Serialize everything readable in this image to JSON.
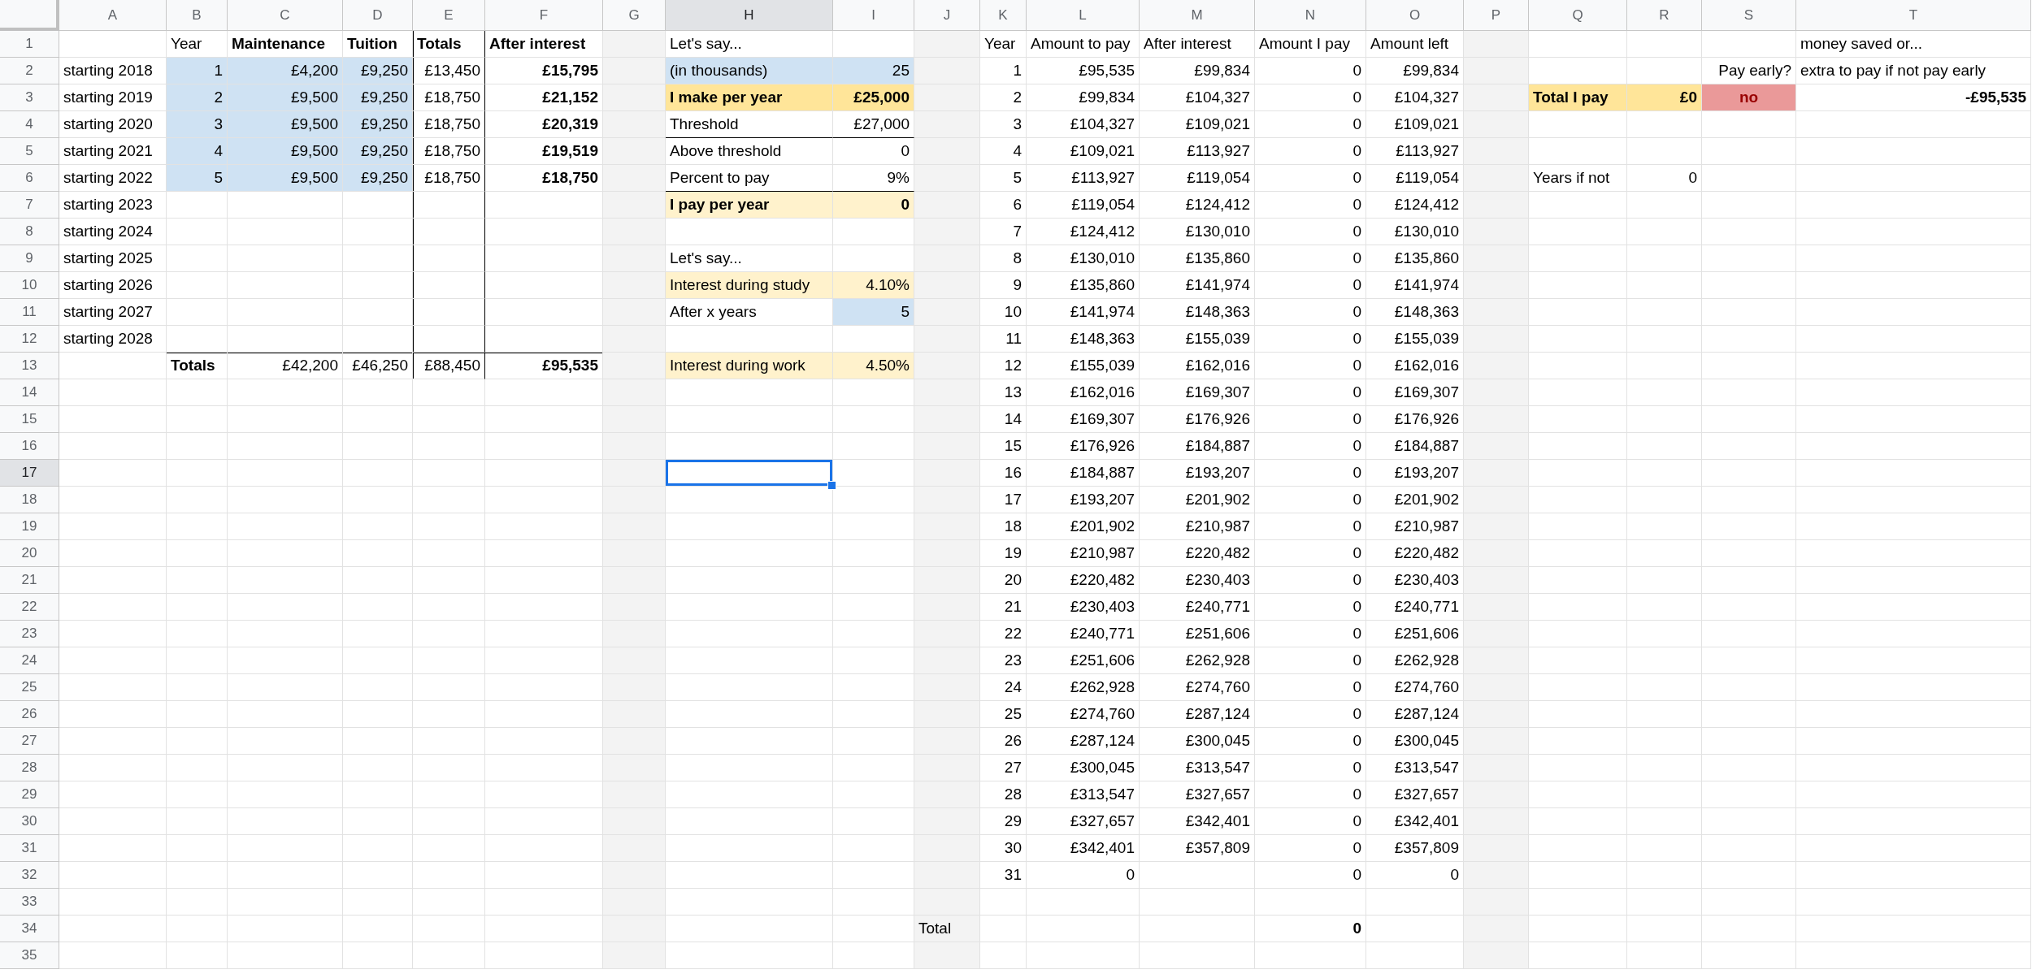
{
  "columns": [
    {
      "label": "A",
      "selected": false
    },
    {
      "label": "B",
      "selected": false
    },
    {
      "label": "C",
      "selected": false
    },
    {
      "label": "D",
      "selected": false
    },
    {
      "label": "E",
      "selected": false
    },
    {
      "label": "F",
      "selected": false
    },
    {
      "label": "G",
      "selected": false,
      "color": "#f3f3f3"
    },
    {
      "label": "H",
      "selected": true
    },
    {
      "label": "I",
      "selected": false
    },
    {
      "label": "J",
      "selected": false,
      "color": "#f3f3f3"
    },
    {
      "label": "K",
      "selected": false
    },
    {
      "label": "L",
      "selected": false
    },
    {
      "label": "M",
      "selected": false
    },
    {
      "label": "N",
      "selected": false
    },
    {
      "label": "O",
      "selected": false
    },
    {
      "label": "P",
      "selected": false,
      "color": "#f3f3f3"
    },
    {
      "label": "Q",
      "selected": false
    },
    {
      "label": "R",
      "selected": false
    },
    {
      "label": "S",
      "selected": false
    },
    {
      "label": "T",
      "selected": false
    }
  ],
  "rows": [
    {
      "number": "1",
      "selected": false,
      "cells": [
        {},
        {
          "text": "Year",
          "kind": "text"
        },
        {
          "text": "Maintenance",
          "kind": "text",
          "bold": true
        },
        {
          "text": "Tuition",
          "kind": "text",
          "bold": true
        },
        {
          "text": "Totals",
          "kind": "text",
          "bold": true,
          "border_left": true,
          "border_right": true
        },
        {
          "text": "After interest",
          "kind": "text",
          "bold": true
        },
        {},
        {
          "text": "Let's say...",
          "kind": "text"
        },
        {},
        {},
        {
          "text": "Year",
          "kind": "text"
        },
        {
          "text": "Amount to pay",
          "kind": "text"
        },
        {
          "text": "After interest",
          "kind": "text"
        },
        {
          "text": "Amount I pay",
          "kind": "text"
        },
        {
          "text": "Amount left",
          "kind": "text"
        },
        {},
        {},
        {},
        {},
        {
          "text": "money saved or...",
          "kind": "text"
        }
      ]
    },
    {
      "number": "2",
      "selected": false,
      "cells": [
        {
          "text": "starting 2018",
          "kind": "text"
        },
        {
          "text": "1",
          "kind": "number",
          "color": "#cfe2f3"
        },
        {
          "text": "£4,200",
          "kind": "number",
          "color": "#cfe2f3"
        },
        {
          "text": "£9,250",
          "kind": "number",
          "color": "#cfe2f3"
        },
        {
          "text": "£13,450",
          "kind": "number",
          "border_left": true,
          "border_right": true
        },
        {
          "text": "£15,795",
          "kind": "number",
          "bold": true
        },
        {},
        {
          "text": "(in thousands)",
          "kind": "text",
          "color": "#cfe2f3"
        },
        {
          "text": "25",
          "kind": "number",
          "color": "#cfe2f3"
        },
        {},
        {
          "text": "1",
          "kind": "number"
        },
        {
          "text": "£95,535",
          "kind": "number"
        },
        {
          "text": "£99,834",
          "kind": "number"
        },
        {
          "text": "0",
          "kind": "number"
        },
        {
          "text": "£99,834",
          "kind": "number"
        },
        {},
        {},
        {},
        {
          "text": "Pay early?",
          "kind": "heading"
        },
        {
          "text": "extra to pay if not pay early",
          "kind": "text"
        }
      ]
    },
    {
      "number": "3",
      "selected": false,
      "cells": [
        {
          "text": "starting 2019",
          "kind": "text"
        },
        {
          "text": "2",
          "kind": "number",
          "color": "#cfe2f3"
        },
        {
          "text": "£9,500",
          "kind": "number",
          "color": "#cfe2f3"
        },
        {
          "text": "£9,250",
          "kind": "number",
          "color": "#cfe2f3"
        },
        {
          "text": "£18,750",
          "kind": "number",
          "border_left": true,
          "border_right": true
        },
        {
          "text": "£21,152",
          "kind": "number",
          "bold": true
        },
        {},
        {
          "text": "I make per year",
          "kind": "text",
          "bold": true,
          "color": "#ffe599"
        },
        {
          "text": "£25,000",
          "kind": "number",
          "bold": true,
          "color": "#ffe599"
        },
        {},
        {
          "text": "2",
          "kind": "number"
        },
        {
          "text": "£99,834",
          "kind": "number"
        },
        {
          "text": "£104,327",
          "kind": "number"
        },
        {
          "text": "0",
          "kind": "number"
        },
        {
          "text": "£104,327",
          "kind": "number"
        },
        {},
        {
          "text": "Total I pay",
          "kind": "text",
          "bold": true,
          "color": "#ffe599"
        },
        {
          "text": "£0",
          "kind": "number",
          "bold": true,
          "color": "#ffe599"
        },
        {
          "text": "no",
          "kind": "flag",
          "bold": true,
          "color": "#ea9999"
        },
        {
          "text": "-£95,535",
          "kind": "number",
          "bold": true
        }
      ]
    },
    {
      "number": "4",
      "selected": false,
      "cells": [
        {
          "text": "starting 2020",
          "kind": "text"
        },
        {
          "text": "3",
          "kind": "number",
          "color": "#cfe2f3"
        },
        {
          "text": "£9,500",
          "kind": "number",
          "color": "#cfe2f3"
        },
        {
          "text": "£9,250",
          "kind": "number",
          "color": "#cfe2f3"
        },
        {
          "text": "£18,750",
          "kind": "number",
          "border_left": true,
          "border_right": true
        },
        {
          "text": "£20,319",
          "kind": "number",
          "bold": true
        },
        {},
        {
          "text": "Threshold",
          "kind": "text",
          "border_bottom": true
        },
        {
          "text": "£27,000",
          "kind": "number",
          "border_bottom": true
        },
        {},
        {
          "text": "3",
          "kind": "number"
        },
        {
          "text": "£104,327",
          "kind": "number"
        },
        {
          "text": "£109,021",
          "kind": "number"
        },
        {
          "text": "0",
          "kind": "number"
        },
        {
          "text": "£109,021",
          "kind": "number"
        }
      ]
    },
    {
      "number": "5",
      "selected": false,
      "cells": [
        {
          "text": "starting 2021",
          "kind": "text"
        },
        {
          "text": "4",
          "kind": "number",
          "color": "#cfe2f3"
        },
        {
          "text": "£9,500",
          "kind": "number",
          "color": "#cfe2f3"
        },
        {
          "text": "£9,250",
          "kind": "number",
          "color": "#cfe2f3"
        },
        {
          "text": "£18,750",
          "kind": "number",
          "border_left": true,
          "border_right": true
        },
        {
          "text": "£19,519",
          "kind": "number",
          "bold": true
        },
        {},
        {
          "text": "Above threshold",
          "kind": "text"
        },
        {
          "text": "0",
          "kind": "number"
        },
        {},
        {
          "text": "4",
          "kind": "number"
        },
        {
          "text": "£109,021",
          "kind": "number"
        },
        {
          "text": "£113,927",
          "kind": "number"
        },
        {
          "text": "0",
          "kind": "number"
        },
        {
          "text": "£113,927",
          "kind": "number"
        }
      ]
    },
    {
      "number": "6",
      "selected": false,
      "cells": [
        {
          "text": "starting 2022",
          "kind": "text"
        },
        {
          "text": "5",
          "kind": "number",
          "color": "#cfe2f3"
        },
        {
          "text": "£9,500",
          "kind": "number",
          "color": "#cfe2f3"
        },
        {
          "text": "£9,250",
          "kind": "number",
          "color": "#cfe2f3"
        },
        {
          "text": "£18,750",
          "kind": "number",
          "border_left": true,
          "border_right": true
        },
        {
          "text": "£18,750",
          "kind": "number",
          "bold": true
        },
        {},
        {
          "text": "Percent to pay",
          "kind": "text",
          "border_bottom": true
        },
        {
          "text": "9%",
          "kind": "number",
          "border_bottom": true
        },
        {},
        {
          "text": "5",
          "kind": "number"
        },
        {
          "text": "£113,927",
          "kind": "number"
        },
        {
          "text": "£119,054",
          "kind": "number"
        },
        {
          "text": "0",
          "kind": "number"
        },
        {
          "text": "£119,054",
          "kind": "number"
        },
        {},
        {
          "text": "Years if not",
          "kind": "text"
        },
        {
          "text": "0",
          "kind": "number"
        }
      ]
    },
    {
      "number": "7",
      "selected": false,
      "cells": [
        {
          "text": "starting 2023",
          "kind": "text"
        },
        {},
        {},
        {},
        {
          "border_left": true,
          "border_right": true
        },
        {},
        {},
        {
          "text": "I pay per year",
          "kind": "text",
          "bold": true,
          "color": "#fff2cc"
        },
        {
          "text": "0",
          "kind": "number",
          "bold": true,
          "color": "#fff2cc"
        },
        {},
        {
          "text": "6",
          "kind": "number"
        },
        {
          "text": "£119,054",
          "kind": "number"
        },
        {
          "text": "£124,412",
          "kind": "number"
        },
        {
          "text": "0",
          "kind": "number"
        },
        {
          "text": "£124,412",
          "kind": "number"
        }
      ]
    },
    {
      "number": "8",
      "selected": false,
      "cells": [
        {
          "text": "starting 2024",
          "kind": "text"
        },
        {},
        {},
        {},
        {
          "border_left": true,
          "border_right": true
        },
        {},
        {},
        {},
        {},
        {},
        {
          "text": "7",
          "kind": "number"
        },
        {
          "text": "£124,412",
          "kind": "number"
        },
        {
          "text": "£130,010",
          "kind": "number"
        },
        {
          "text": "0",
          "kind": "number"
        },
        {
          "text": "£130,010",
          "kind": "number"
        }
      ]
    },
    {
      "number": "9",
      "selected": false,
      "cells": [
        {
          "text": "starting 2025",
          "kind": "text"
        },
        {},
        {},
        {},
        {
          "border_left": true,
          "border_right": true
        },
        {},
        {},
        {
          "text": "Let's say...",
          "kind": "text"
        },
        {},
        {},
        {
          "text": "8",
          "kind": "number"
        },
        {
          "text": "£130,010",
          "kind": "number"
        },
        {
          "text": "£135,860",
          "kind": "number"
        },
        {
          "text": "0",
          "kind": "number"
        },
        {
          "text": "£135,860",
          "kind": "number"
        }
      ]
    },
    {
      "number": "10",
      "selected": false,
      "cells": [
        {
          "text": "starting 2026",
          "kind": "text"
        },
        {},
        {},
        {},
        {
          "border_left": true,
          "border_right": true
        },
        {},
        {},
        {
          "text": "Interest during study",
          "kind": "text",
          "color": "#fff2cc"
        },
        {
          "text": "4.10%",
          "kind": "number",
          "color": "#fff2cc"
        },
        {},
        {
          "text": "9",
          "kind": "number"
        },
        {
          "text": "£135,860",
          "kind": "number"
        },
        {
          "text": "£141,974",
          "kind": "number"
        },
        {
          "text": "0",
          "kind": "number"
        },
        {
          "text": "£141,974",
          "kind": "number"
        }
      ]
    },
    {
      "number": "11",
      "selected": false,
      "cells": [
        {
          "text": "starting 2027",
          "kind": "text"
        },
        {},
        {},
        {},
        {
          "border_left": true,
          "border_right": true
        },
        {},
        {},
        {
          "text": "After x years",
          "kind": "text"
        },
        {
          "text": "5",
          "kind": "number",
          "color": "#cfe2f3"
        },
        {},
        {
          "text": "10",
          "kind": "number"
        },
        {
          "text": "£141,974",
          "kind": "number"
        },
        {
          "text": "£148,363",
          "kind": "number"
        },
        {
          "text": "0",
          "kind": "number"
        },
        {
          "text": "£148,363",
          "kind": "number"
        }
      ]
    },
    {
      "number": "12",
      "selected": false,
      "cells": [
        {
          "text": "starting 2028",
          "kind": "text"
        },
        {},
        {},
        {},
        {
          "border_left": true,
          "border_right": true
        },
        {},
        {},
        {},
        {},
        {},
        {
          "text": "11",
          "kind": "number"
        },
        {
          "text": "£148,363",
          "kind": "number"
        },
        {
          "text": "£155,039",
          "kind": "number"
        },
        {
          "text": "0",
          "kind": "number"
        },
        {
          "text": "£155,039",
          "kind": "number"
        }
      ]
    },
    {
      "number": "13",
      "selected": false,
      "cells": [
        {},
        {
          "text": "Totals",
          "kind": "text",
          "bold": true,
          "border_top": true
        },
        {
          "text": "£42,200",
          "kind": "number",
          "border_top": true
        },
        {
          "text": "£46,250",
          "kind": "number",
          "border_top": true
        },
        {
          "text": "£88,450",
          "kind": "number",
          "border_top": true,
          "border_left": true,
          "border_right": true
        },
        {
          "text": "£95,535",
          "kind": "number",
          "bold": true,
          "border_top": true
        },
        {},
        {
          "text": "Interest during work",
          "kind": "text",
          "color": "#fff2cc"
        },
        {
          "text": "4.50%",
          "kind": "number",
          "color": "#fff2cc"
        },
        {},
        {
          "text": "12",
          "kind": "number"
        },
        {
          "text": "£155,039",
          "kind": "number"
        },
        {
          "text": "£162,016",
          "kind": "number"
        },
        {
          "text": "0",
          "kind": "number"
        },
        {
          "text": "£162,016",
          "kind": "number"
        }
      ]
    },
    {
      "number": "14",
      "selected": false,
      "cells": [
        {},
        {},
        {},
        {},
        {},
        {},
        {},
        {},
        {},
        {},
        {
          "text": "13",
          "kind": "number"
        },
        {
          "text": "£162,016",
          "kind": "number"
        },
        {
          "text": "£169,307",
          "kind": "number"
        },
        {
          "text": "0",
          "kind": "number"
        },
        {
          "text": "£169,307",
          "kind": "number"
        }
      ]
    },
    {
      "number": "15",
      "selected": false,
      "cells": [
        {},
        {},
        {},
        {},
        {},
        {},
        {},
        {},
        {},
        {},
        {
          "text": "14",
          "kind": "number"
        },
        {
          "text": "£169,307",
          "kind": "number"
        },
        {
          "text": "£176,926",
          "kind": "number"
        },
        {
          "text": "0",
          "kind": "number"
        },
        {
          "text": "£176,926",
          "kind": "number"
        }
      ]
    },
    {
      "number": "16",
      "selected": false,
      "cells": [
        {},
        {},
        {},
        {},
        {},
        {},
        {},
        {},
        {},
        {},
        {
          "text": "15",
          "kind": "number"
        },
        {
          "text": "£176,926",
          "kind": "number"
        },
        {
          "text": "£184,887",
          "kind": "number"
        },
        {
          "text": "0",
          "kind": "number"
        },
        {
          "text": "£184,887",
          "kind": "number"
        }
      ]
    },
    {
      "number": "17",
      "selected": true,
      "cells": [
        {},
        {},
        {},
        {},
        {},
        {},
        {},
        {},
        {},
        {},
        {
          "text": "16",
          "kind": "number"
        },
        {
          "text": "£184,887",
          "kind": "number"
        },
        {
          "text": "£193,207",
          "kind": "number"
        },
        {
          "text": "0",
          "kind": "number"
        },
        {
          "text": "£193,207",
          "kind": "number"
        }
      ]
    },
    {
      "number": "18",
      "selected": false,
      "cells": [
        {},
        {},
        {},
        {},
        {},
        {},
        {},
        {},
        {},
        {},
        {
          "text": "17",
          "kind": "number"
        },
        {
          "text": "£193,207",
          "kind": "number"
        },
        {
          "text": "£201,902",
          "kind": "number"
        },
        {
          "text": "0",
          "kind": "number"
        },
        {
          "text": "£201,902",
          "kind": "number"
        }
      ]
    },
    {
      "number": "19",
      "selected": false,
      "cells": [
        {},
        {},
        {},
        {},
        {},
        {},
        {},
        {},
        {},
        {},
        {
          "text": "18",
          "kind": "number"
        },
        {
          "text": "£201,902",
          "kind": "number"
        },
        {
          "text": "£210,987",
          "kind": "number"
        },
        {
          "text": "0",
          "kind": "number"
        },
        {
          "text": "£210,987",
          "kind": "number"
        }
      ]
    },
    {
      "number": "20",
      "selected": false,
      "cells": [
        {},
        {},
        {},
        {},
        {},
        {},
        {},
        {},
        {},
        {},
        {
          "text": "19",
          "kind": "number"
        },
        {
          "text": "£210,987",
          "kind": "number"
        },
        {
          "text": "£220,482",
          "kind": "number"
        },
        {
          "text": "0",
          "kind": "number"
        },
        {
          "text": "£220,482",
          "kind": "number"
        }
      ]
    },
    {
      "number": "21",
      "selected": false,
      "cells": [
        {},
        {},
        {},
        {},
        {},
        {},
        {},
        {},
        {},
        {},
        {
          "text": "20",
          "kind": "number"
        },
        {
          "text": "£220,482",
          "kind": "number"
        },
        {
          "text": "£230,403",
          "kind": "number"
        },
        {
          "text": "0",
          "kind": "number"
        },
        {
          "text": "£230,403",
          "kind": "number"
        }
      ]
    },
    {
      "number": "22",
      "selected": false,
      "cells": [
        {},
        {},
        {},
        {},
        {},
        {},
        {},
        {},
        {},
        {},
        {
          "text": "21",
          "kind": "number"
        },
        {
          "text": "£230,403",
          "kind": "number"
        },
        {
          "text": "£240,771",
          "kind": "number"
        },
        {
          "text": "0",
          "kind": "number"
        },
        {
          "text": "£240,771",
          "kind": "number"
        }
      ]
    },
    {
      "number": "23",
      "selected": false,
      "cells": [
        {},
        {},
        {},
        {},
        {},
        {},
        {},
        {},
        {},
        {},
        {
          "text": "22",
          "kind": "number"
        },
        {
          "text": "£240,771",
          "kind": "number"
        },
        {
          "text": "£251,606",
          "kind": "number"
        },
        {
          "text": "0",
          "kind": "number"
        },
        {
          "text": "£251,606",
          "kind": "number"
        }
      ]
    },
    {
      "number": "24",
      "selected": false,
      "cells": [
        {},
        {},
        {},
        {},
        {},
        {},
        {},
        {},
        {},
        {},
        {
          "text": "23",
          "kind": "number"
        },
        {
          "text": "£251,606",
          "kind": "number"
        },
        {
          "text": "£262,928",
          "kind": "number"
        },
        {
          "text": "0",
          "kind": "number"
        },
        {
          "text": "£262,928",
          "kind": "number"
        }
      ]
    },
    {
      "number": "25",
      "selected": false,
      "cells": [
        {},
        {},
        {},
        {},
        {},
        {},
        {},
        {},
        {},
        {},
        {
          "text": "24",
          "kind": "number"
        },
        {
          "text": "£262,928",
          "kind": "number"
        },
        {
          "text": "£274,760",
          "kind": "number"
        },
        {
          "text": "0",
          "kind": "number"
        },
        {
          "text": "£274,760",
          "kind": "number"
        }
      ]
    },
    {
      "number": "26",
      "selected": false,
      "cells": [
        {},
        {},
        {},
        {},
        {},
        {},
        {},
        {},
        {},
        {},
        {
          "text": "25",
          "kind": "number"
        },
        {
          "text": "£274,760",
          "kind": "number"
        },
        {
          "text": "£287,124",
          "kind": "number"
        },
        {
          "text": "0",
          "kind": "number"
        },
        {
          "text": "£287,124",
          "kind": "number"
        }
      ]
    },
    {
      "number": "27",
      "selected": false,
      "cells": [
        {},
        {},
        {},
        {},
        {},
        {},
        {},
        {},
        {},
        {},
        {
          "text": "26",
          "kind": "number"
        },
        {
          "text": "£287,124",
          "kind": "number"
        },
        {
          "text": "£300,045",
          "kind": "number"
        },
        {
          "text": "0",
          "kind": "number"
        },
        {
          "text": "£300,045",
          "kind": "number"
        }
      ]
    },
    {
      "number": "28",
      "selected": false,
      "cells": [
        {},
        {},
        {},
        {},
        {},
        {},
        {},
        {},
        {},
        {},
        {
          "text": "27",
          "kind": "number"
        },
        {
          "text": "£300,045",
          "kind": "number"
        },
        {
          "text": "£313,547",
          "kind": "number"
        },
        {
          "text": "0",
          "kind": "number"
        },
        {
          "text": "£313,547",
          "kind": "number"
        }
      ]
    },
    {
      "number": "29",
      "selected": false,
      "cells": [
        {},
        {},
        {},
        {},
        {},
        {},
        {},
        {},
        {},
        {},
        {
          "text": "28",
          "kind": "number"
        },
        {
          "text": "£313,547",
          "kind": "number"
        },
        {
          "text": "£327,657",
          "kind": "number"
        },
        {
          "text": "0",
          "kind": "number"
        },
        {
          "text": "£327,657",
          "kind": "number"
        }
      ]
    },
    {
      "number": "30",
      "selected": false,
      "cells": [
        {},
        {},
        {},
        {},
        {},
        {},
        {},
        {},
        {},
        {},
        {
          "text": "29",
          "kind": "number"
        },
        {
          "text": "£327,657",
          "kind": "number"
        },
        {
          "text": "£342,401",
          "kind": "number"
        },
        {
          "text": "0",
          "kind": "number"
        },
        {
          "text": "£342,401",
          "kind": "number"
        }
      ]
    },
    {
      "number": "31",
      "selected": false,
      "cells": [
        {},
        {},
        {},
        {},
        {},
        {},
        {},
        {},
        {},
        {},
        {
          "text": "30",
          "kind": "number"
        },
        {
          "text": "£342,401",
          "kind": "number"
        },
        {
          "text": "£357,809",
          "kind": "number"
        },
        {
          "text": "0",
          "kind": "number"
        },
        {
          "text": "£357,809",
          "kind": "number"
        }
      ]
    },
    {
      "number": "32",
      "selected": false,
      "cells": [
        {},
        {},
        {},
        {},
        {},
        {},
        {},
        {},
        {},
        {},
        {
          "text": "31",
          "kind": "number"
        },
        {
          "text": "0",
          "kind": "number"
        },
        {},
        {
          "text": "0",
          "kind": "number"
        },
        {
          "text": "0",
          "kind": "number"
        }
      ]
    },
    {
      "number": "33",
      "selected": false,
      "cells": []
    },
    {
      "number": "34",
      "selected": false,
      "cells": [
        {},
        {},
        {},
        {},
        {},
        {},
        {},
        {},
        {},
        {
          "text": "Total",
          "kind": "text"
        },
        {},
        {},
        {},
        {
          "text": "0",
          "kind": "number",
          "bold": true
        }
      ]
    },
    {
      "number": "35",
      "selected": false,
      "cells": []
    }
  ]
}
